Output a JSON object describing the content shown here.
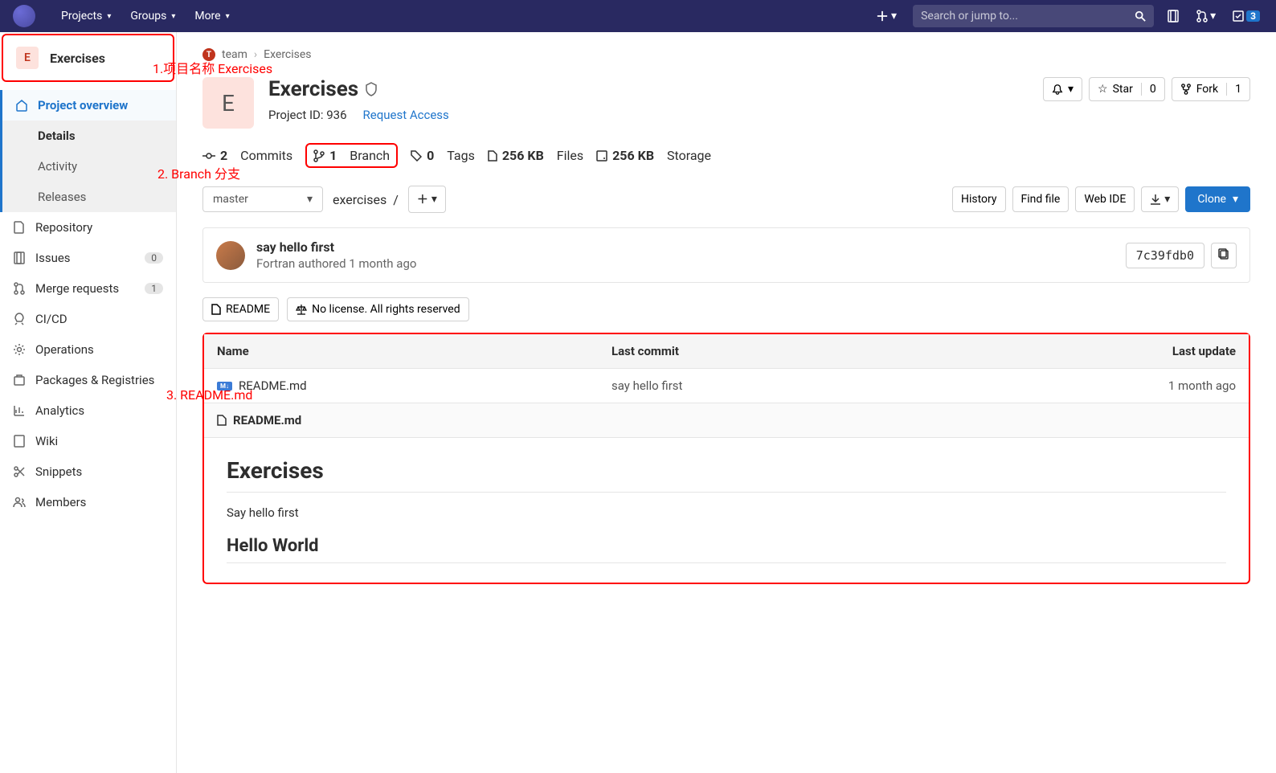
{
  "navbar": {
    "items": [
      "Projects",
      "Groups",
      "More"
    ],
    "search_placeholder": "Search or jump to...",
    "todo_count": "3"
  },
  "sidebar": {
    "project_letter": "E",
    "project_name": "Exercises",
    "overview_label": "Project overview",
    "sub_items": [
      "Details",
      "Activity",
      "Releases"
    ],
    "items": [
      {
        "label": "Repository"
      },
      {
        "label": "Issues",
        "badge": "0"
      },
      {
        "label": "Merge requests",
        "badge": "1"
      },
      {
        "label": "CI/CD"
      },
      {
        "label": "Operations"
      },
      {
        "label": "Packages & Registries"
      },
      {
        "label": "Analytics"
      },
      {
        "label": "Wiki"
      },
      {
        "label": "Snippets"
      },
      {
        "label": "Members"
      }
    ]
  },
  "annotations": {
    "a1": "1.项目名称 Exercises",
    "a2": "2. Branch 分支",
    "a3": "3. README.md"
  },
  "breadcrumb": {
    "group_letter": "T",
    "group": "team",
    "project": "Exercises"
  },
  "project": {
    "avatar_letter": "E",
    "name": "Exercises",
    "id_label": "Project ID: 936",
    "request_access": "Request Access",
    "star_label": "Star",
    "star_count": "0",
    "fork_label": "Fork",
    "fork_count": "1"
  },
  "stats": {
    "commits_n": "2",
    "commits_label": "Commits",
    "branch_n": "1",
    "branch_label": "Branch",
    "tags_n": "0",
    "tags_label": "Tags",
    "files_size": "256 KB",
    "files_label": "Files",
    "storage_size": "256 KB",
    "storage_label": "Storage"
  },
  "controls": {
    "branch": "master",
    "path": "exercises",
    "history": "History",
    "find_file": "Find file",
    "web_ide": "Web IDE",
    "clone": "Clone"
  },
  "last_commit": {
    "message": "say hello first",
    "author": "Fortran",
    "authored": "authored 1 month ago",
    "sha": "7c39fdb0"
  },
  "quick": {
    "readme": "README",
    "license": "No license. All rights reserved"
  },
  "table": {
    "h_name": "Name",
    "h_commit": "Last commit",
    "h_update": "Last update",
    "rows": [
      {
        "name": "README.md",
        "commit": "say hello first",
        "update": "1 month ago"
      }
    ]
  },
  "readme": {
    "filename": "README.md",
    "h1": "Exercises",
    "p1": "Say hello first",
    "h2": "Hello World"
  }
}
